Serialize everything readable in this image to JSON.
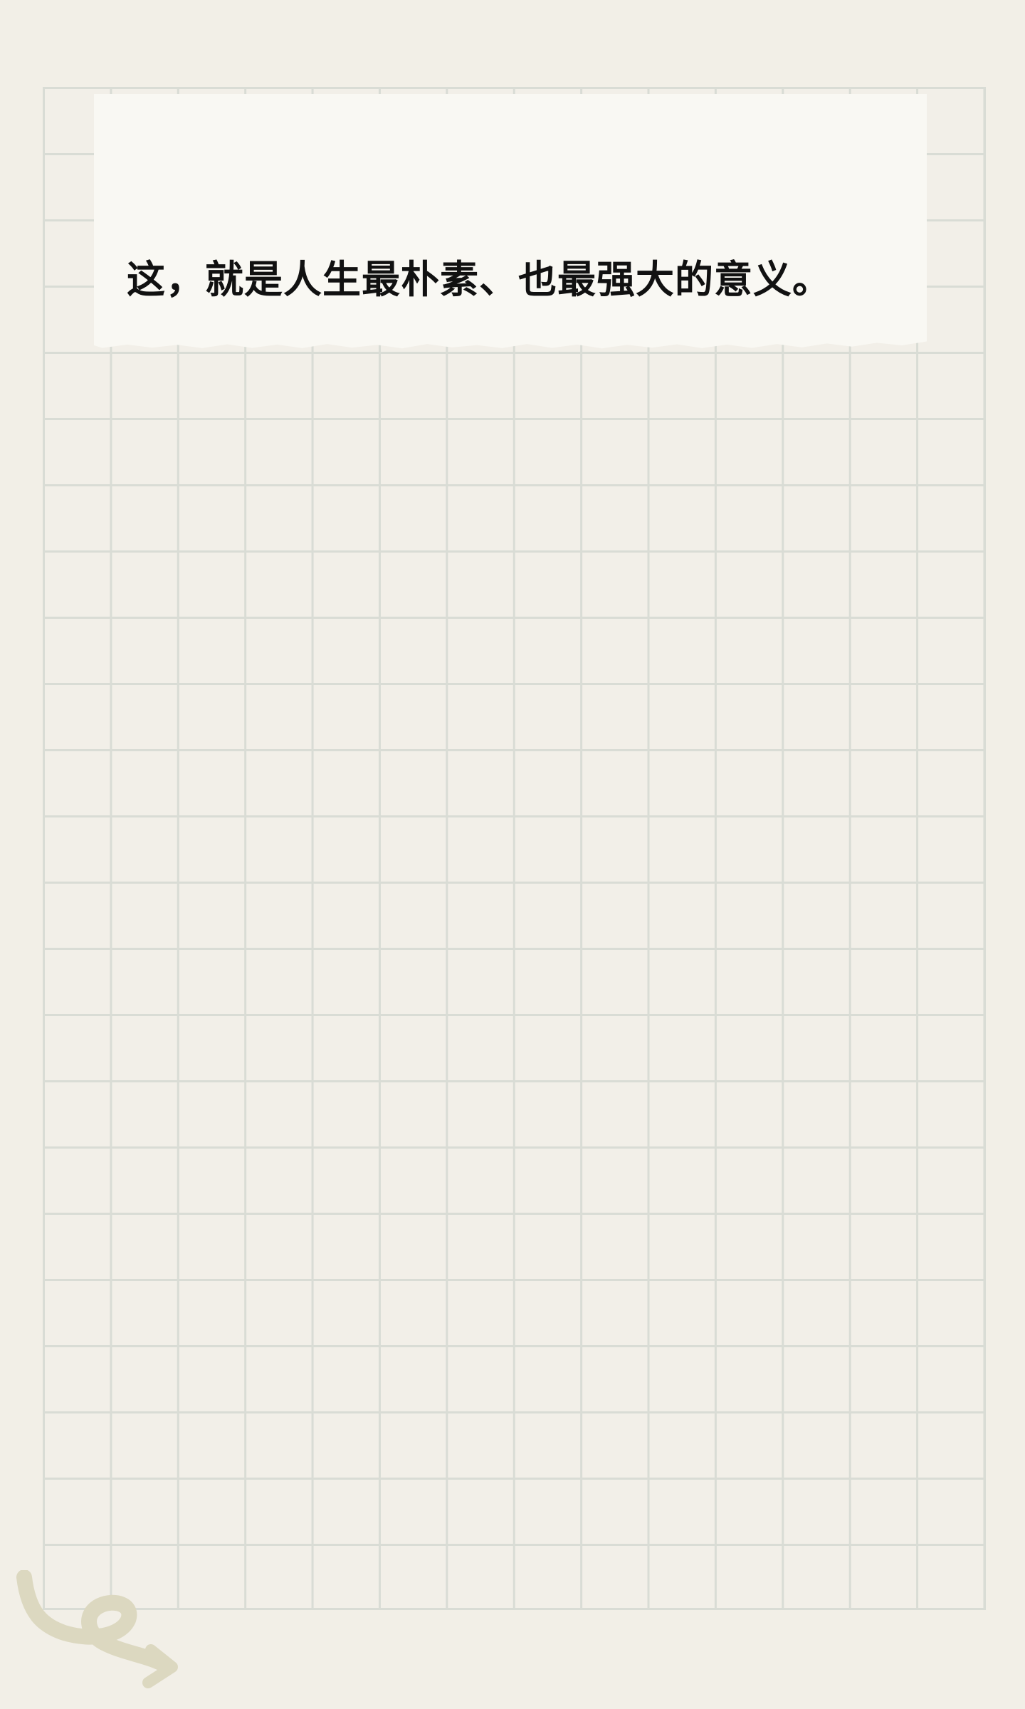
{
  "note": {
    "text": "这，就是人生最朴素、也最强大的意义。"
  },
  "colors": {
    "background": "#f2efe7",
    "grid_line": "#d9dcd5",
    "card": "#f9f8f3",
    "text": "#111111",
    "doodle": "#dcd8c0"
  },
  "icons": {
    "decoration": "squiggle-arrow-icon"
  }
}
